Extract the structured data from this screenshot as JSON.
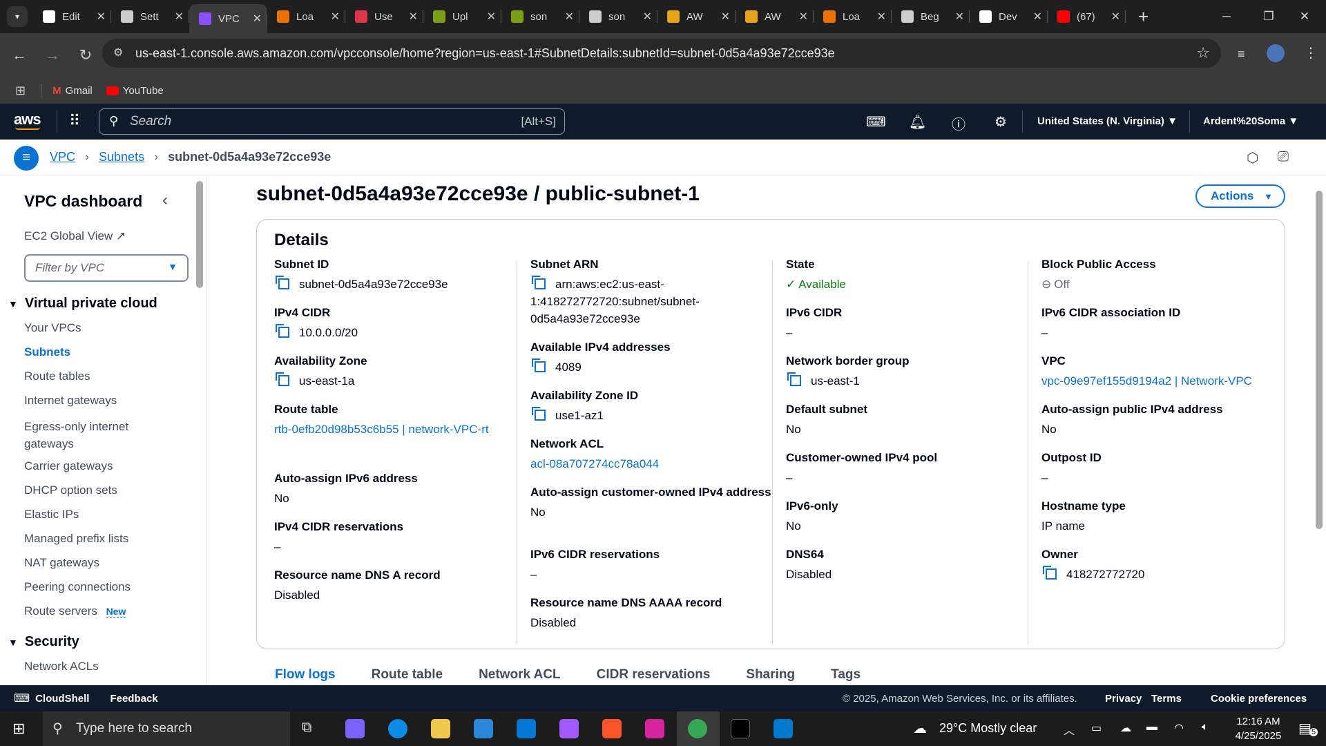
{
  "browser": {
    "tabs": [
      {
        "label": "Edit",
        "icon": "github-icon",
        "color": "#ffffff"
      },
      {
        "label": "Sett",
        "icon": "gear-icon",
        "color": "#cccccc"
      },
      {
        "label": "VPC",
        "icon": "vpc-icon",
        "color": "#8c4fff",
        "active": true
      },
      {
        "label": "Loa",
        "icon": "aws-service-icon",
        "color": "#ed7100"
      },
      {
        "label": "Use",
        "icon": "aws-service-icon",
        "color": "#dd344c"
      },
      {
        "label": "Upl",
        "icon": "aws-service-icon",
        "color": "#7aa116"
      },
      {
        "label": "son",
        "icon": "aws-service-icon",
        "color": "#7aa116"
      },
      {
        "label": "son",
        "icon": "globe-icon",
        "color": "#cccccc"
      },
      {
        "label": "AW",
        "icon": "box-icon",
        "color": "#e8a317"
      },
      {
        "label": "AW",
        "icon": "box-icon",
        "color": "#e8a317"
      },
      {
        "label": "Loa",
        "icon": "aws-service-icon",
        "color": "#ed7100"
      },
      {
        "label": "Beg",
        "icon": "globe-icon",
        "color": "#cccccc"
      },
      {
        "label": "Dev",
        "icon": "github-icon",
        "color": "#ffffff"
      },
      {
        "label": "(67)",
        "icon": "youtube-icon",
        "color": "#ff0000"
      }
    ],
    "url": "us-east-1.console.aws.amazon.com/vpcconsole/home?region=us-east-1#SubnetDetails:subnetId=subnet-0d5a4a93e72cce93e",
    "bookmarks": [
      {
        "label": "Gmail",
        "icon": "gmail-icon"
      },
      {
        "label": "YouTube",
        "icon": "youtube-icon"
      }
    ]
  },
  "aws_nav": {
    "logo": "aws",
    "search_placeholder": "Search",
    "search_shortcut": "[Alt+S]",
    "region": "United States (N. Virginia)",
    "account": "Ardent%20Soma"
  },
  "breadcrumb": {
    "items": [
      "VPC",
      "Subnets"
    ],
    "current": "subnet-0d5a4a93e72cce93e"
  },
  "sidebar": {
    "title": "VPC dashboard",
    "global_view": "EC2 Global View",
    "filter_placeholder": "Filter by VPC",
    "section1": "Virtual private cloud",
    "items": [
      "Your VPCs",
      "Subnets",
      "Route tables",
      "Internet gateways",
      "Egress-only internet gateways",
      "Carrier gateways",
      "DHCP option sets",
      "Elastic IPs",
      "Managed prefix lists",
      "NAT gateways",
      "Peering connections",
      "Route servers"
    ],
    "new_badge": "New",
    "section2": "Security",
    "security_items": [
      "Network ACLs"
    ]
  },
  "page": {
    "title": "subnet-0d5a4a93e72cce93e / public-subnet-1",
    "actions_label": "Actions",
    "details_title": "Details"
  },
  "details": {
    "col1": [
      {
        "label": "Subnet ID",
        "value": "subnet-0d5a4a93e72cce93e",
        "copy": true
      },
      {
        "label": "IPv4 CIDR",
        "value": "10.0.0.0/20",
        "copy": true
      },
      {
        "label": "Availability Zone",
        "value": "us-east-1a",
        "copy": true
      },
      {
        "label": "Route table",
        "value": "rtb-0efb20d98b53c6b55 | network-VPC-rt",
        "link": true
      },
      {
        "label": "Auto-assign IPv6 address",
        "value": "No"
      },
      {
        "label": "IPv4 CIDR reservations",
        "value": "–"
      },
      {
        "label": "Resource name DNS A record",
        "value": "Disabled"
      }
    ],
    "col2": [
      {
        "label": "Subnet ARN",
        "value": "arn:aws:ec2:us-east-1:418272772720:subnet/subnet-0d5a4a93e72cce93e",
        "copy": true
      },
      {
        "label": "Available IPv4 addresses",
        "value": "4089",
        "copy": true
      },
      {
        "label": "Availability Zone ID",
        "value": "use1-az1",
        "copy": true
      },
      {
        "label": "Network ACL",
        "value": "acl-08a707274cc78a044",
        "link": true
      },
      {
        "label": "Auto-assign customer-owned IPv4 address",
        "value": "No"
      },
      {
        "label": "IPv6 CIDR reservations",
        "value": "–"
      },
      {
        "label": "Resource name DNS AAAA record",
        "value": "Disabled"
      }
    ],
    "col3": [
      {
        "label": "State",
        "value": "Available",
        "status": "success"
      },
      {
        "label": "IPv6 CIDR",
        "value": "–"
      },
      {
        "label": "Network border group",
        "value": "us-east-1",
        "copy": true
      },
      {
        "label": "Default subnet",
        "value": "No"
      },
      {
        "label": "Customer-owned IPv4 pool",
        "value": "–"
      },
      {
        "label": "IPv6-only",
        "value": "No"
      },
      {
        "label": "DNS64",
        "value": "Disabled"
      }
    ],
    "col4": [
      {
        "label": "Block Public Access",
        "value": "Off",
        "status": "off"
      },
      {
        "label": "IPv6 CIDR association ID",
        "value": "–"
      },
      {
        "label": "VPC",
        "value": "vpc-09e97ef155d9194a2 | Network-VPC",
        "link": true
      },
      {
        "label": "Auto-assign public IPv4 address",
        "value": "No"
      },
      {
        "label": "Outpost ID",
        "value": "–"
      },
      {
        "label": "Hostname type",
        "value": "IP name"
      },
      {
        "label": "Owner",
        "value": "418272772720",
        "copy": true
      }
    ]
  },
  "bottom_tabs": [
    "Flow logs",
    "Route table",
    "Network ACL",
    "CIDR reservations",
    "Sharing",
    "Tags"
  ],
  "footer": {
    "cloudshell": "CloudShell",
    "feedback": "Feedback",
    "copyright": "© 2025, Amazon Web Services, Inc. or its affiliates.",
    "links": [
      "Privacy",
      "Terms",
      "Cookie preferences"
    ]
  },
  "taskbar": {
    "search_placeholder": "Type here to search",
    "weather": "29°C  Mostly clear",
    "time": "12:16 AM",
    "date": "4/25/2025",
    "notification_count": "5"
  },
  "colors": {
    "aws_nav": "#0f1b2a",
    "link": "#0972d3",
    "success": "#037f0c"
  }
}
